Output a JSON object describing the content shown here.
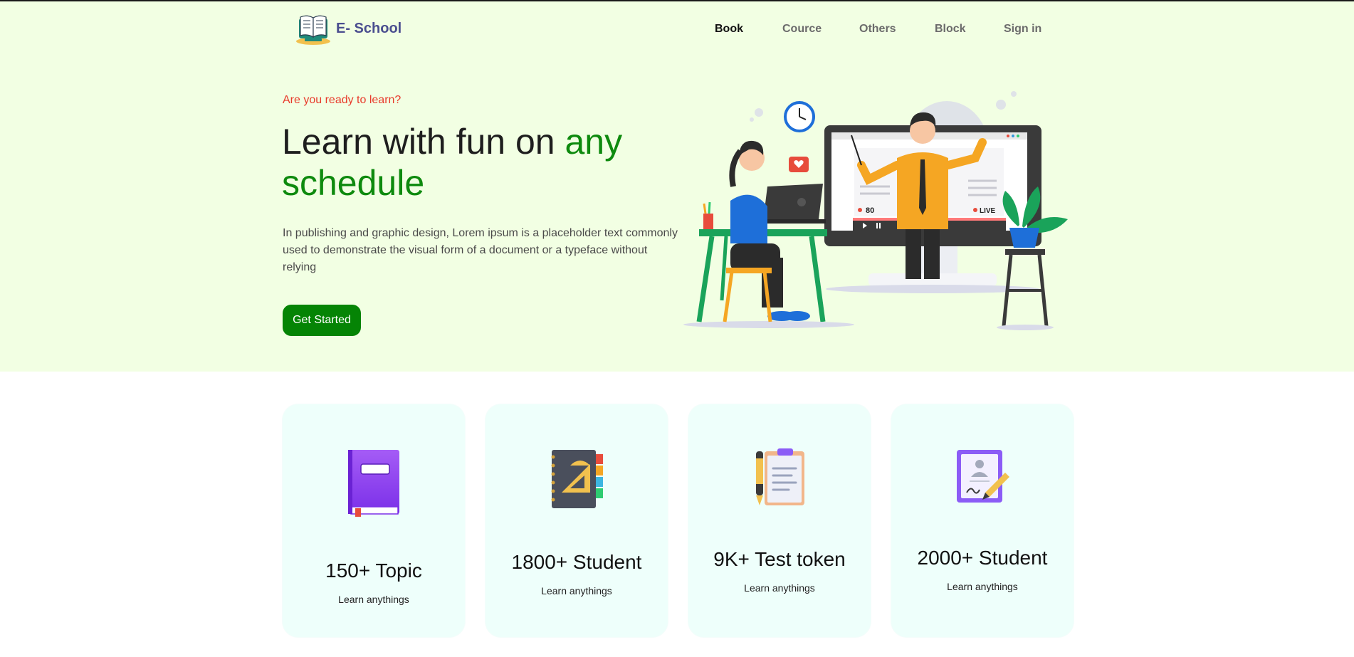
{
  "brand": {
    "name": "E- School",
    "logo_icon": "open-book-logo-icon"
  },
  "nav": {
    "items": [
      {
        "label": "Book",
        "active": true
      },
      {
        "label": "Cource",
        "active": false
      },
      {
        "label": "Others",
        "active": false
      },
      {
        "label": "Block",
        "active": false
      },
      {
        "label": "Sign in",
        "active": false
      }
    ]
  },
  "hero": {
    "eyebrow": "Are you ready to learn?",
    "headline_main": "Learn with fun on ",
    "headline_accent_1": "any",
    "headline_accent_2": "schedule",
    "description": "In publishing and graphic design, Lorem ipsum is a placeholder text commonly used to demonstrate the visual form of a document or a typeface without relying",
    "cta_label": "Get Started",
    "illustration": {
      "icon": "online-teaching-illustration",
      "viewer_count": "80",
      "live_label": "LIVE"
    }
  },
  "colors": {
    "hero_bg": "#f2ffe3",
    "accent_green": "#0e8a0e",
    "button_green": "#058405",
    "eyebrow_red": "#e83a2a",
    "brand_text": "#4a4e8f",
    "card_bg": "#eefffb"
  },
  "stats": [
    {
      "value": "150+ Topic",
      "caption": "Learn anythings",
      "icon": "purple-book-icon"
    },
    {
      "value": "1800+ Student",
      "caption": "Learn anythings",
      "icon": "notebook-ruler-icon"
    },
    {
      "value": "9K+ Test token",
      "caption": "Learn anythings",
      "icon": "clipboard-pen-icon"
    },
    {
      "value": "2000+ Student",
      "caption": "Learn anythings",
      "icon": "certificate-pen-icon"
    }
  ]
}
